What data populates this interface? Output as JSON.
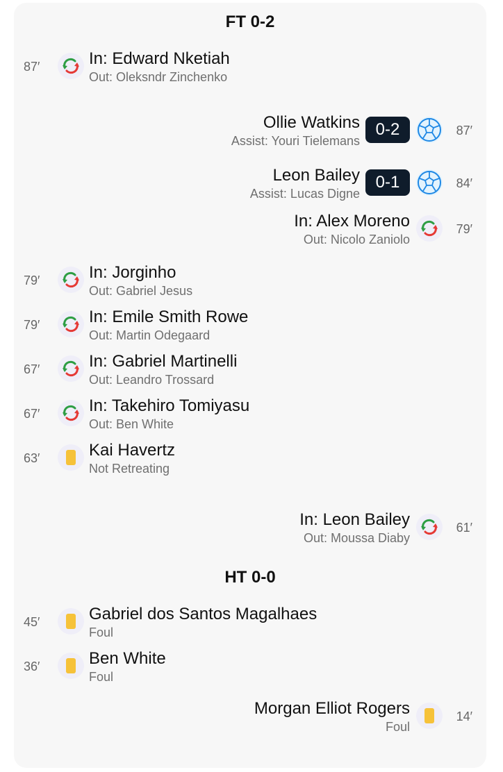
{
  "periods": {
    "ft": "FT 0-2",
    "ht": "HT 0-0"
  },
  "events": [
    {
      "side": "left",
      "type": "sub",
      "minute": "87′",
      "main": "In: Edward Nketiah",
      "sub": "Out: Oleksndr Zinchenko"
    },
    {
      "side": "right",
      "type": "goal",
      "minute": "87′",
      "main": "Ollie Watkins",
      "sub": "Assist: Youri Tielemans",
      "score": "0-2"
    },
    {
      "side": "right",
      "type": "goal",
      "minute": "84′",
      "main": "Leon Bailey",
      "sub": "Assist: Lucas Digne",
      "score": "0-1"
    },
    {
      "side": "right",
      "type": "sub",
      "minute": "79′",
      "main": "In: Alex Moreno",
      "sub": "Out: Nicolo Zaniolo"
    },
    {
      "side": "left",
      "type": "sub",
      "minute": "79′",
      "main": "In: Jorginho",
      "sub": "Out: Gabriel Jesus"
    },
    {
      "side": "left",
      "type": "sub",
      "minute": "79′",
      "main": "In: Emile Smith Rowe",
      "sub": "Out: Martin Odegaard"
    },
    {
      "side": "left",
      "type": "sub",
      "minute": "67′",
      "main": "In: Gabriel Martinelli",
      "sub": "Out: Leandro Trossard"
    },
    {
      "side": "left",
      "type": "sub",
      "minute": "67′",
      "main": "In: Takehiro Tomiyasu",
      "sub": "Out: Ben White"
    },
    {
      "side": "left",
      "type": "yellow",
      "minute": "63′",
      "main": "Kai Havertz",
      "sub": "Not Retreating"
    },
    {
      "side": "right",
      "type": "sub",
      "minute": "61′",
      "main": "In: Leon Bailey",
      "sub": "Out: Moussa Diaby"
    },
    {
      "side": "left",
      "type": "yellow",
      "minute": "45′",
      "main": "Gabriel dos Santos Magalhaes",
      "sub": "Foul"
    },
    {
      "side": "left",
      "type": "yellow",
      "minute": "36′",
      "main": "Ben White",
      "sub": "Foul"
    },
    {
      "side": "right",
      "type": "yellow",
      "minute": "14′",
      "main": "Morgan Elliot Rogers",
      "sub": "Foul"
    }
  ],
  "colors": {
    "card_bg": "#f7f7f7",
    "score_bg": "#0f1c2b",
    "yellow": "#f6c23a",
    "sub_in": "#2e9e44",
    "sub_out": "#e53935",
    "ball": "#1e88e5"
  },
  "icons": {
    "sub": "substitution-icon",
    "goal": "football-icon",
    "yellow": "yellow-card-icon"
  }
}
